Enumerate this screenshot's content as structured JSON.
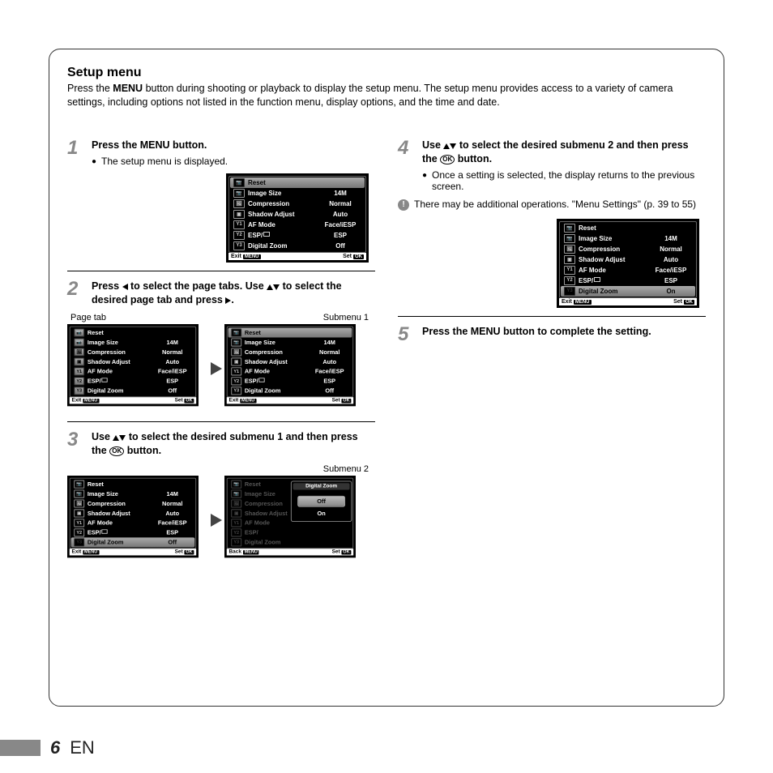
{
  "title": "Setup menu",
  "intro_a": "Press the ",
  "intro_b": "MENU",
  "intro_c": " button during shooting or playback to display the setup menu. The setup menu provides access to a variety of camera settings, including options not listed in the function menu, display options, and the time and date.",
  "step1": {
    "head_a": "Press the ",
    "head_b": "MENU",
    "head_c": " button.",
    "bullet": "The setup menu is displayed."
  },
  "step2": {
    "head_a": "Press ",
    "head_b": " to select the page tabs. Use ",
    "head_c": " to select the desired page tab and press ",
    "head_d": ".",
    "anno_left": "Page tab",
    "anno_right": "Submenu 1"
  },
  "step3": {
    "head_a": "Use ",
    "head_b": " to select the desired submenu 1 and then press the ",
    "head_c": " button.",
    "anno_right": "Submenu 2",
    "ok": "OK"
  },
  "step4": {
    "head_a": "Use ",
    "head_b": " to select the desired submenu 2 and then press the ",
    "head_c": " button.",
    "bullet": "Once a setting is selected, the display returns to the previous screen.",
    "note": "There may be additional operations. \"Menu Settings\" (p. 39 to 55)",
    "ok": "OK"
  },
  "step5": {
    "head_a": "Press the ",
    "head_b": "MENU",
    "head_c": " button to complete the setting."
  },
  "cam": {
    "rows": [
      {
        "icon": "📷",
        "label": "Reset",
        "val": ""
      },
      {
        "icon": "📷",
        "label": "Image Size",
        "val": "14M"
      },
      {
        "icon": "🖼",
        "label": "Compression",
        "val": "Normal"
      },
      {
        "icon": "▣",
        "label": "Shadow Adjust",
        "val": "Auto"
      },
      {
        "icon": "Y1",
        "label": "AF Mode",
        "val": "Face/iESP"
      },
      {
        "icon": "Y2",
        "label": "ESP/",
        "val": "ESP"
      },
      {
        "icon": "Y3",
        "label": "Digital Zoom",
        "val": "Off"
      }
    ],
    "rows_on": [
      {
        "icon": "📷",
        "label": "Reset",
        "val": ""
      },
      {
        "icon": "📷",
        "label": "Image Size",
        "val": "14M"
      },
      {
        "icon": "🖼",
        "label": "Compression",
        "val": "Normal"
      },
      {
        "icon": "▣",
        "label": "Shadow Adjust",
        "val": "Auto"
      },
      {
        "icon": "Y1",
        "label": "AF Mode",
        "val": "Face/iESP"
      },
      {
        "icon": "Y2",
        "label": "ESP/",
        "val": "ESP"
      },
      {
        "icon": "Y3",
        "label": "Digital Zoom",
        "val": "On"
      }
    ],
    "popup": {
      "title": "Digital Zoom",
      "opt1": "Off",
      "opt2": "On"
    },
    "footer_exit": "Exit",
    "footer_back": "Back",
    "footer_set": "Set",
    "footer_menu": "MENU",
    "footer_ok": "OK"
  },
  "footer": {
    "page": "6",
    "lang": "EN"
  }
}
